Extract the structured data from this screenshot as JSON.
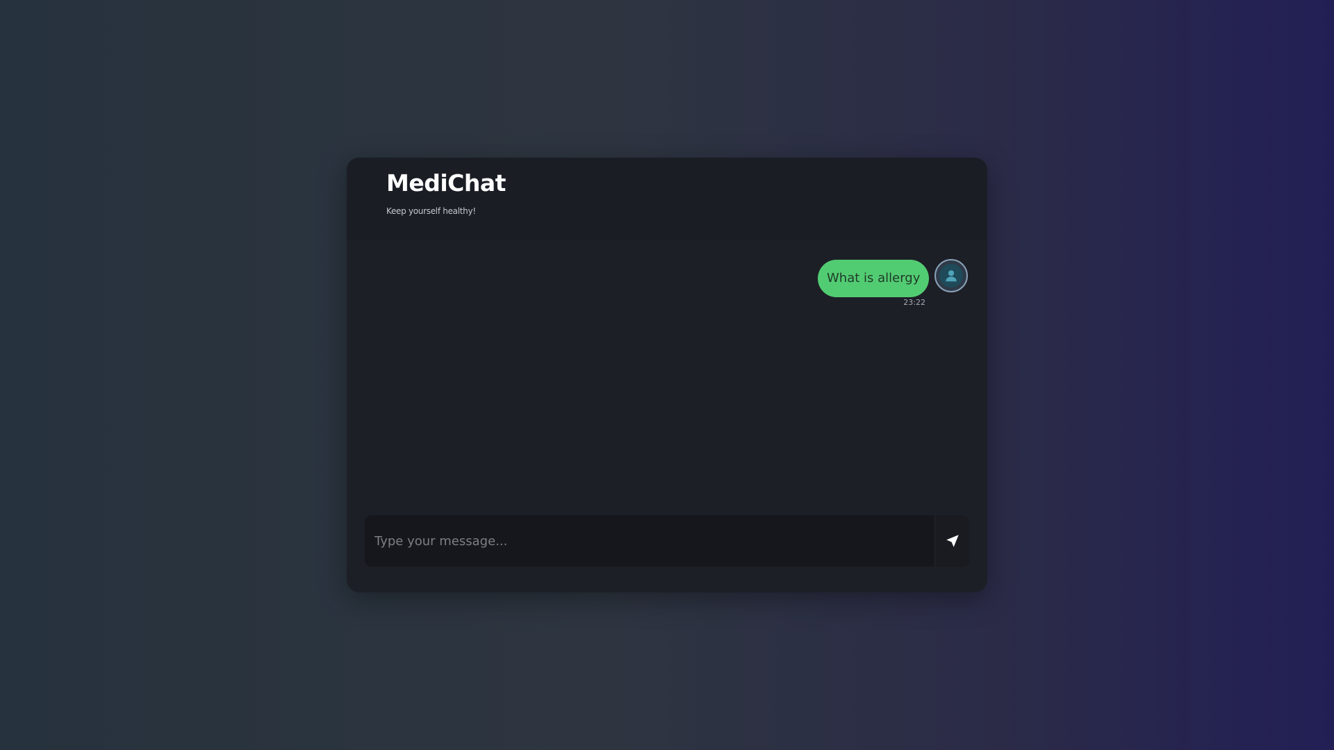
{
  "header": {
    "title": "MediChat",
    "subtitle": "Keep yourself healthy!"
  },
  "messages": [
    {
      "sender": "user",
      "text": "What is allergy",
      "time": "23:22",
      "avatar_icon": "user-icon"
    }
  ],
  "composer": {
    "placeholder": "Type your message...",
    "value": "",
    "send_icon": "send-icon"
  },
  "colors": {
    "user_bubble": "#52cc72",
    "card_background": "#1d1f27",
    "input_background": "#16171c"
  }
}
